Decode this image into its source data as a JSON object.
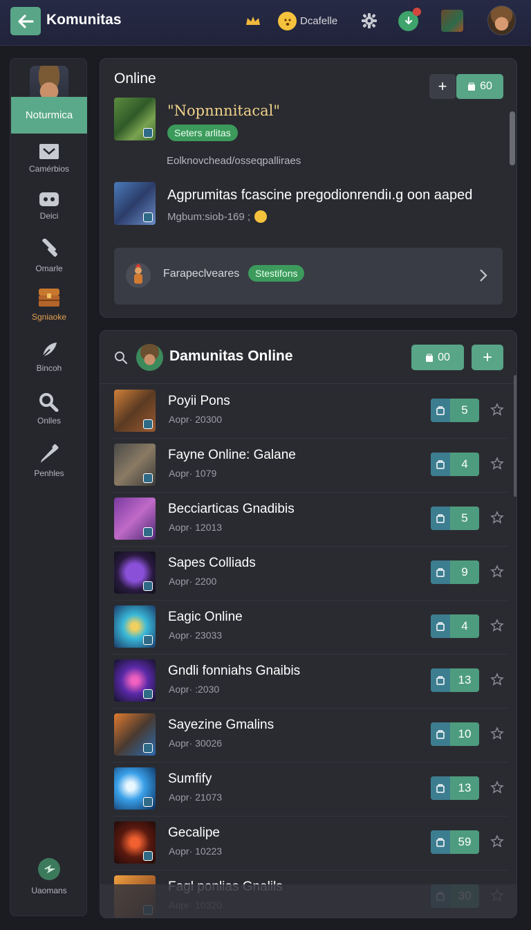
{
  "topbar": {
    "title": "Komunitas",
    "user_label": "Dcafelle",
    "icons": [
      "back-arrow-icon",
      "crown-icon",
      "emoji-icon",
      "gear-icon",
      "notification-icon",
      "game-icon",
      "avatar"
    ]
  },
  "sidebar": {
    "profile_label": "Noturmica",
    "items": [
      {
        "label": "Camérbios",
        "icon": "inbox-icon"
      },
      {
        "label": "Deici",
        "icon": "gamepad-icon"
      },
      {
        "label": "Omarle",
        "icon": "tools-icon"
      },
      {
        "label": "Sgniaoke",
        "icon": "chest-icon",
        "active": true
      },
      {
        "label": "Bincoh",
        "icon": "feather-icon"
      },
      {
        "label": "Onlles",
        "icon": "search-icon"
      },
      {
        "label": "Penhles",
        "icon": "pen-icon"
      }
    ],
    "bottom_label": "Uaomans"
  },
  "online": {
    "title": "Online",
    "add_button": "+",
    "count_button": "60",
    "featured_title": "\"Nopnnnitacal\"",
    "featured_badge": "Seters arlitas",
    "description": "Eolknovchead/osseqpalliraes",
    "second_title": "Agprumitas fcascine pregodionrendiı.g oon aaped",
    "second_meta": "Mgbum:siob-169 ;",
    "promo_label": "Farapeclveares",
    "promo_badge": "Stestifons"
  },
  "list": {
    "title": "Damunitas Online",
    "count_button": "00",
    "add_button": "+",
    "rows": [
      {
        "name": "Poyii Pons",
        "meta": "Aopr· 20300",
        "count": "5"
      },
      {
        "name": "Fayne Online: Galane",
        "meta": "Aopr· 1079",
        "count": "4"
      },
      {
        "name": "Becciarticas Gnadibis",
        "meta": "Aopr· 12013",
        "count": "5"
      },
      {
        "name": "Sapes Colliads",
        "meta": "Aopr· 2200",
        "count": "9"
      },
      {
        "name": "Eagic Online",
        "meta": "Aopr· 23033",
        "count": "4"
      },
      {
        "name": "Gndli fonniahs Gnaibis",
        "meta": "Aopr· :2030",
        "count": "13"
      },
      {
        "name": "Sayezine Gmalins",
        "meta": "Aopr· 30026",
        "count": "10"
      },
      {
        "name": "Sumfify",
        "meta": "Aopr· 21073",
        "count": "13"
      },
      {
        "name": "Gecalipe",
        "meta": "Aopr· 10223",
        "count": "59"
      },
      {
        "name": "Fagl ponlias Gnalils",
        "meta": "Aopr· 10320",
        "count": "30"
      }
    ]
  },
  "colors": {
    "accent": "#58a587",
    "background": "#1a1c22",
    "panel": "#2a2b31",
    "badge": "#3c9b5c"
  }
}
